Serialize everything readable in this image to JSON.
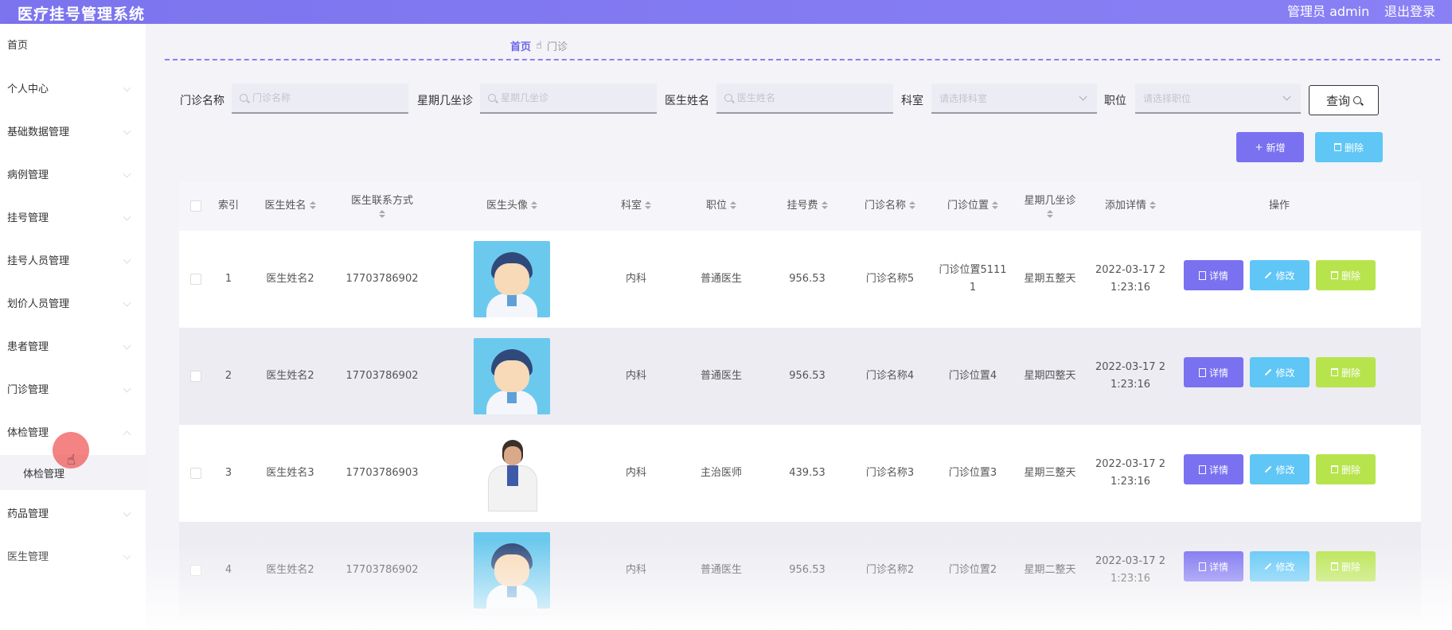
{
  "app": {
    "title": "医疗挂号管理系统",
    "admin": "管理员 admin",
    "logout": "退出登录"
  },
  "sidebar": {
    "items": [
      {
        "label": "首页"
      },
      {
        "label": "个人中心"
      },
      {
        "label": "基础数据管理"
      },
      {
        "label": "病例管理"
      },
      {
        "label": "挂号管理"
      },
      {
        "label": "挂号人员管理"
      },
      {
        "label": "划价人员管理"
      },
      {
        "label": "患者管理"
      },
      {
        "label": "门诊管理"
      },
      {
        "label": "体检管理"
      },
      {
        "label": "体检管理"
      },
      {
        "label": "药品管理"
      },
      {
        "label": "医生管理"
      }
    ]
  },
  "breadcrumb": {
    "home": "首页",
    "sep_icon": "hand-pointer-icon",
    "current": "门诊"
  },
  "search": {
    "fields": [
      {
        "label": "门诊名称",
        "placeholder": "门诊名称"
      },
      {
        "label": "星期几坐诊",
        "placeholder": "星期几坐诊"
      },
      {
        "label": "医生姓名",
        "placeholder": "医生姓名"
      }
    ],
    "selects": [
      {
        "label": "科室",
        "placeholder": "请选择科室"
      },
      {
        "label": "职位",
        "placeholder": "请选择职位"
      }
    ],
    "query_label": "查询"
  },
  "actions": {
    "add_label": "新增",
    "delete_label": "删除"
  },
  "table": {
    "headers": [
      "索引",
      "医生姓名",
      "医生联系方式",
      "医生头像",
      "科室",
      "职位",
      "挂号费",
      "门诊名称",
      "门诊位置",
      "星期几坐诊",
      "添加详情",
      "操作"
    ],
    "op_labels": {
      "detail": "详情",
      "edit": "修改",
      "delete": "删除"
    },
    "rows": [
      {
        "index": "1",
        "name": "医生姓名2",
        "phone": "17703786902",
        "avatar": "cartoon-doctor",
        "dept": "内科",
        "position": "普通医生",
        "fee": "956.53",
        "clinic": "门诊名称5",
        "location_1": "门诊位置5111",
        "location_2": "1",
        "day": "星期五整天",
        "time_1": "2022-03-17 2",
        "time_2": "1:23:16"
      },
      {
        "index": "2",
        "name": "医生姓名2",
        "phone": "17703786902",
        "avatar": "cartoon-doctor",
        "dept": "内科",
        "position": "普通医生",
        "fee": "956.53",
        "clinic": "门诊名称4",
        "location_1": "门诊位置4",
        "location_2": "",
        "day": "星期四整天",
        "time_1": "2022-03-17 2",
        "time_2": "1:23:16"
      },
      {
        "index": "3",
        "name": "医生姓名3",
        "phone": "17703786903",
        "avatar": "photo-doctor",
        "dept": "内科",
        "position": "主治医师",
        "fee": "439.53",
        "clinic": "门诊名称3",
        "location_1": "门诊位置3",
        "location_2": "",
        "day": "星期三整天",
        "time_1": "2022-03-17 2",
        "time_2": "1:23:16"
      },
      {
        "index": "4",
        "name": "医生姓名2",
        "phone": "17703786902",
        "avatar": "cartoon-doctor",
        "dept": "内科",
        "position": "普通医生",
        "fee": "956.53",
        "clinic": "门诊名称2",
        "location_1": "门诊位置2",
        "location_2": "",
        "day": "星期二整天",
        "time_1": "2022-03-17 2",
        "time_2": "1:23:16"
      }
    ]
  },
  "colors": {
    "primary": "#7a71f0",
    "info": "#5fc6f6",
    "success": "#b7e44d",
    "header": "#7b74ee"
  }
}
